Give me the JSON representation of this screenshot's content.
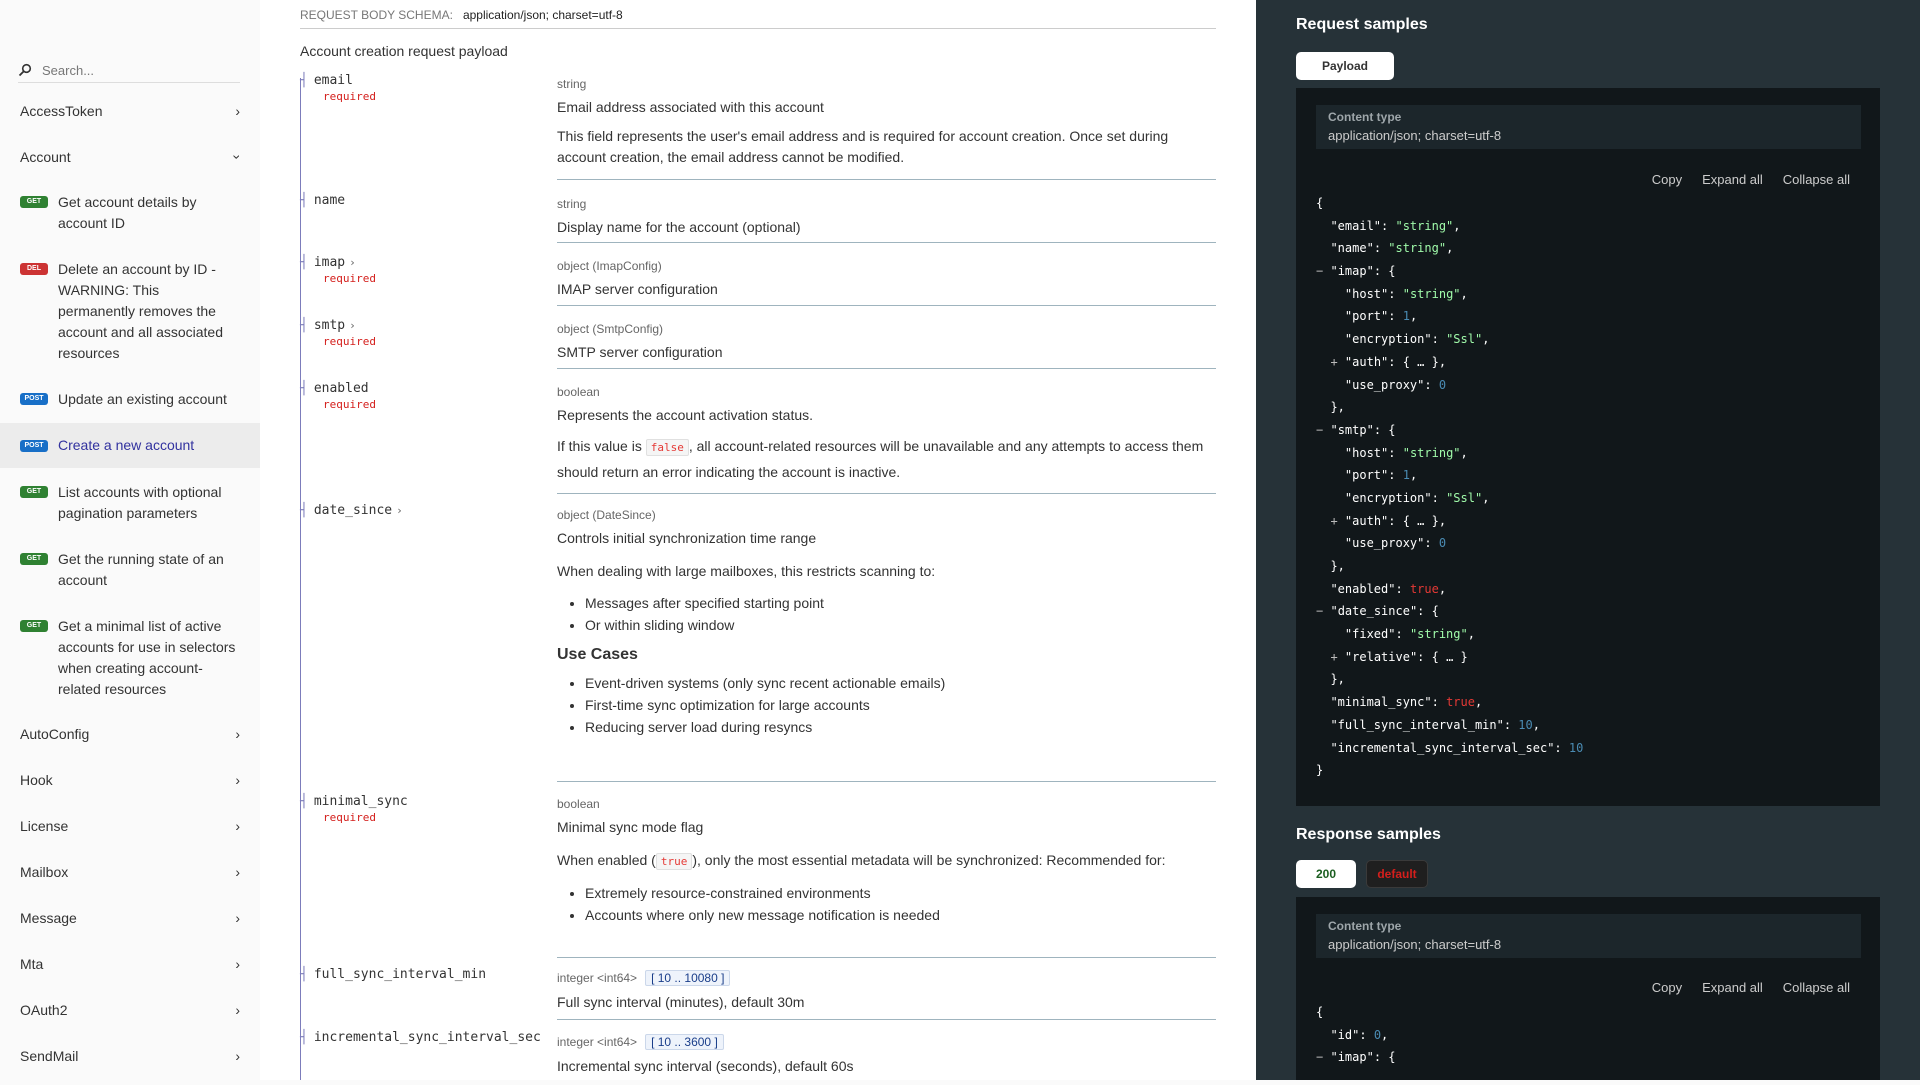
{
  "sidebar": {
    "search_placeholder": "Search...",
    "groups": [
      {
        "label": "AccessToken"
      },
      {
        "label": "Account"
      },
      {
        "label": "AutoConfig"
      },
      {
        "label": "Hook"
      },
      {
        "label": "License"
      },
      {
        "label": "Mailbox"
      },
      {
        "label": "Message"
      },
      {
        "label": "Mta"
      },
      {
        "label": "OAuth2"
      },
      {
        "label": "SendMail"
      }
    ],
    "operations": [
      {
        "method": "GET",
        "label": "Get account details by account ID"
      },
      {
        "method": "DEL",
        "label": "Delete an account by ID - WARNING: This permanently removes the account and all associated resources"
      },
      {
        "method": "POST",
        "label": "Update an existing account"
      },
      {
        "method": "POST",
        "label": "Create a new account"
      },
      {
        "method": "GET",
        "label": "List accounts with optional pagination parameters"
      },
      {
        "method": "GET",
        "label": "Get the running state of an account"
      },
      {
        "method": "GET",
        "label": "Get a minimal list of active accounts for use in selectors when creating account-related resources"
      }
    ]
  },
  "main": {
    "schema_label": "REQUEST BODY SCHEMA:",
    "schema_value": "application/json; charset=utf-8",
    "description": "Account creation request payload",
    "required_label": "required",
    "properties": {
      "email": {
        "name": "email",
        "type": "string",
        "summary": "Email address associated with this account",
        "detail": "This field represents the user's email address and is required for account creation. Once set during account creation, the email address cannot be modified."
      },
      "name": {
        "name": "name",
        "type": "string",
        "summary": "Display name for the account (optional)"
      },
      "imap": {
        "name": "imap",
        "type": "object (ImapConfig)",
        "summary": "IMAP server configuration"
      },
      "smtp": {
        "name": "smtp",
        "type": "object (SmtpConfig)",
        "summary": "SMTP server configuration"
      },
      "enabled": {
        "name": "enabled",
        "type": "boolean",
        "summary": "Represents the account activation status.",
        "detail_pre": "If this value is",
        "detail_code": "false",
        "detail_post": ", all account-related resources will be unavailable and any attempts to access them should return an error indicating the account is inactive."
      },
      "date_since": {
        "name": "date_since",
        "type": "object (DateSince)",
        "summary": "Controls initial synchronization time range",
        "detail": "When dealing with large mailboxes, this restricts scanning to:",
        "bullets": [
          "Messages after specified starting point",
          "Or within sliding window"
        ],
        "heading": "Use Cases",
        "use_cases": [
          "Event-driven systems (only sync recent actionable emails)",
          "First-time sync optimization for large accounts",
          "Reducing server load during resyncs"
        ]
      },
      "minimal_sync": {
        "name": "minimal_sync",
        "type": "boolean",
        "summary": "Minimal sync mode flag",
        "detail_pre": "When enabled (",
        "detail_code": "true",
        "detail_post": "), only the most essential metadata will be synchronized: Recommended for:",
        "bullets": [
          "Extremely resource-constrained environments",
          "Accounts where only new message notification is needed"
        ]
      },
      "full_sync_interval_min": {
        "name": "full_sync_interval_min",
        "type": "integer <int64>",
        "range": "[ 10 .. 10080 ]",
        "summary": "Full sync interval (minutes), default 30m"
      },
      "incremental_sync_interval_sec": {
        "name": "incremental_sync_interval_sec",
        "type": "integer <int64>",
        "range": "[ 10 .. 3600 ]",
        "summary": "Incremental sync interval (seconds), default 60s"
      }
    }
  },
  "right": {
    "request_title": "Request samples",
    "payload_tab": "Payload",
    "content_type_label": "Content type",
    "content_type_value": "application/json; charset=utf-8",
    "copy": "Copy",
    "expand_all": "Expand all",
    "collapse_all": "Collapse all",
    "request_json": [
      "{",
      "  \"email\": \"string\",",
      "  \"name\": \"string\",",
      "  \"imap\": {",
      "    \"host\": \"string\",",
      "    \"port\": 1,",
      "    \"encryption\": \"Ssl\",",
      "    \"auth\": { … },",
      "    \"use_proxy\": 0",
      "  },",
      "  \"smtp\": {",
      "    \"host\": \"string\",",
      "    \"port\": 1,",
      "    \"encryption\": \"Ssl\",",
      "    \"auth\": { … },",
      "    \"use_proxy\": 0",
      "  },",
      "  \"enabled\": true,",
      "  \"date_since\": {",
      "    \"fixed\": \"string\",",
      "    \"relative\": { … }",
      "  },",
      "  \"minimal_sync\": true,",
      "  \"full_sync_interval_min\": 10,",
      "  \"incremental_sync_interval_sec\": 10",
      "}"
    ],
    "response_title": "Response samples",
    "response_tabs": [
      "200",
      "default"
    ],
    "response_json": [
      "{",
      "  \"id\": 0,",
      "  \"imap\": {"
    ],
    "colors": {
      "tab_ok": "#1b5e20",
      "tab_default": "#d41f1c"
    }
  }
}
